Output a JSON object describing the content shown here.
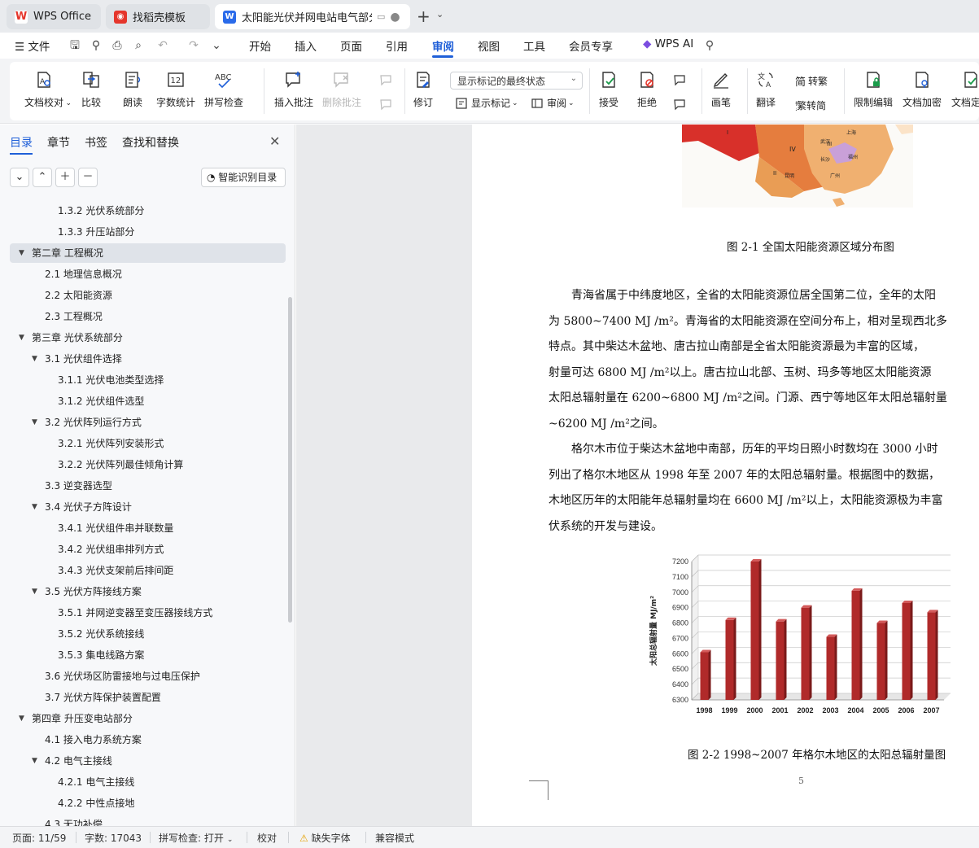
{
  "tabs": [
    {
      "label": "WPS Office",
      "icon": "wps-logo-icon",
      "active": false
    },
    {
      "label": "找稻壳模板",
      "icon": "docer-logo-icon",
      "active": false
    },
    {
      "label": "太阳能光伏并网电站电气部分…",
      "icon": "word-doc-icon",
      "active": true
    }
  ],
  "menubar": {
    "file": "文件",
    "items": [
      "开始",
      "插入",
      "页面",
      "引用",
      "审阅",
      "视图",
      "工具",
      "会员专享"
    ],
    "active": "审阅",
    "ai": "WPS AI"
  },
  "ribbon": {
    "doc_check": "文档校对",
    "compare": "比较",
    "read_aloud": "朗读",
    "word_count": "字数统计",
    "spell_check": "拼写检查",
    "insert_comment": "插入批注",
    "delete_comment": "删除批注",
    "track_changes": "修订",
    "markup_select": "显示标记的最终状态",
    "show_markup": "显示标记",
    "review": "审阅",
    "accept": "接受",
    "reject": "拒绝",
    "pen": "画笔",
    "translate": "翻译",
    "to_traditional": "转繁",
    "to_simplified": "繁转简",
    "restrict_edit": "限制编辑",
    "encrypt": "文档加密",
    "finalize": "文档定稿"
  },
  "nav": {
    "tabs": [
      "目录",
      "章节",
      "书签",
      "查找和替换"
    ],
    "active_tab": "目录",
    "smart_toc": "智能识别目录",
    "toc": [
      {
        "text": "1.3.2  光伏系统部分",
        "level": 3,
        "caret": false
      },
      {
        "text": "1.3.3  升压站部分",
        "level": 3,
        "caret": false
      },
      {
        "text": "第二章  工程概况",
        "level": 1,
        "caret": true,
        "selected": true
      },
      {
        "text": "2.1  地理信息概况",
        "level": 2,
        "caret": false
      },
      {
        "text": "2.2  太阳能资源",
        "level": 2,
        "caret": false
      },
      {
        "text": "2.3  工程概况",
        "level": 2,
        "caret": false
      },
      {
        "text": "第三章  光伏系统部分",
        "level": 1,
        "caret": true
      },
      {
        "text": "3.1 光伏组件选择",
        "level": 2,
        "caret": true
      },
      {
        "text": "3.1.1  光伏电池类型选择",
        "level": 3,
        "caret": false
      },
      {
        "text": "3.1.2  光伏组件选型",
        "level": 3,
        "caret": false
      },
      {
        "text": "3.2  光伏阵列运行方式",
        "level": 2,
        "caret": true
      },
      {
        "text": "3.2.1  光伏阵列安装形式",
        "level": 3,
        "caret": false
      },
      {
        "text": "3.2.2  光伏阵列最佳倾角计算",
        "level": 3,
        "caret": false
      },
      {
        "text": "3.3  逆变器选型",
        "level": 2,
        "caret": false
      },
      {
        "text": "3.4  光伏子方阵设计",
        "level": 2,
        "caret": true
      },
      {
        "text": "3.4.1  光伏组件串并联数量",
        "level": 3,
        "caret": false
      },
      {
        "text": "3.4.2  光伏组串排列方式",
        "level": 3,
        "caret": false
      },
      {
        "text": "3.4.3  光伏支架前后排间距",
        "level": 3,
        "caret": false
      },
      {
        "text": "3.5  光伏方阵接线方案",
        "level": 2,
        "caret": true
      },
      {
        "text": "3.5.1  并网逆变器至变压器接线方式",
        "level": 3,
        "caret": false
      },
      {
        "text": "3.5.2  光伏系统接线",
        "level": 3,
        "caret": false
      },
      {
        "text": "3.5.3  集电线路方案",
        "level": 3,
        "caret": false
      },
      {
        "text": "3.6  光伏场区防雷接地与过电压保护",
        "level": 2,
        "caret": false
      },
      {
        "text": "3.7  光伏方阵保护装置配置",
        "level": 2,
        "caret": false
      },
      {
        "text": "第四章  升压变电站部分",
        "level": 1,
        "caret": true
      },
      {
        "text": "4.1  接入电力系统方案",
        "level": 2,
        "caret": false
      },
      {
        "text": "4.2  电气主接线",
        "level": 2,
        "caret": true
      },
      {
        "text": "4.2.1  电气主接线",
        "level": 3,
        "caret": false
      },
      {
        "text": "4.2.2  中性点接地",
        "level": 3,
        "caret": false
      },
      {
        "text": "4.3  无功补偿",
        "level": 2,
        "caret": false
      }
    ]
  },
  "doc": {
    "fig1_caption": "图 2-1  全国太阳能资源区域分布图",
    "map_labels": [
      "I",
      "II",
      "III",
      "IV",
      "武汉",
      "上海",
      "长沙",
      "福州",
      "广州",
      "昆明"
    ],
    "para1": [
      "青海省属于中纬度地区，全省的太阳能资源位居全国第二位，全年的太阳",
      "为 5800~7400 MJ /m²。青海省的太阳能资源在空间分布上，相对呈现西北多",
      "特点。其中柴达木盆地、唐古拉山南部是全省太阳能资源最为丰富的区域，",
      "射量可达 6800 MJ /m²以上。唐古拉山北部、玉树、玛多等地区太阳能资源",
      "太阳总辐射量在 6200~6800 MJ /m²之间。门源、西宁等地区年太阳总辐射量",
      "~6200 MJ /m²之间。"
    ],
    "para2": [
      "格尔木市位于柴达木盆地中南部，历年的平均日照小时数均在 3000 小时",
      "列出了格尔木地区从 1998 年至 2007 年的太阳总辐射量。根据图中的数据，",
      "木地区历年的太阳能年总辐射量均在 6600 MJ /m²以上，太阳能资源极为丰富",
      "伏系统的开发与建设。"
    ],
    "fig2_caption": "图 2-2  1998~2007 年格尔木地区的太阳总辐射量图",
    "page_number": "5"
  },
  "chart_data": {
    "type": "bar",
    "categories": [
      "1998",
      "1999",
      "2000",
      "2001",
      "2002",
      "2003",
      "2004",
      "2005",
      "2006",
      "2007"
    ],
    "values": [
      6610,
      6820,
      7200,
      6810,
      6900,
      6710,
      7010,
      6800,
      6930,
      6870
    ],
    "title": "",
    "xlabel": "",
    "ylabel": "太阳总辐射量 MJ/m²",
    "yticks": [
      "6300",
      "6400",
      "6500",
      "6600",
      "6700",
      "6800",
      "6900",
      "7000",
      "7100",
      "7200"
    ],
    "ylim": [
      6300,
      7200
    ],
    "grid": true,
    "bar_color": "#b02a2a"
  },
  "status": {
    "page": "页面: 11/59",
    "words": "字数: 17043",
    "spell": "拼写检查: 打开",
    "proof": "校对",
    "missing_font": "缺失字体",
    "compat": "兼容模式"
  },
  "colors": {
    "accent": "#1f5fd8",
    "wps_red": "#e5362c"
  }
}
